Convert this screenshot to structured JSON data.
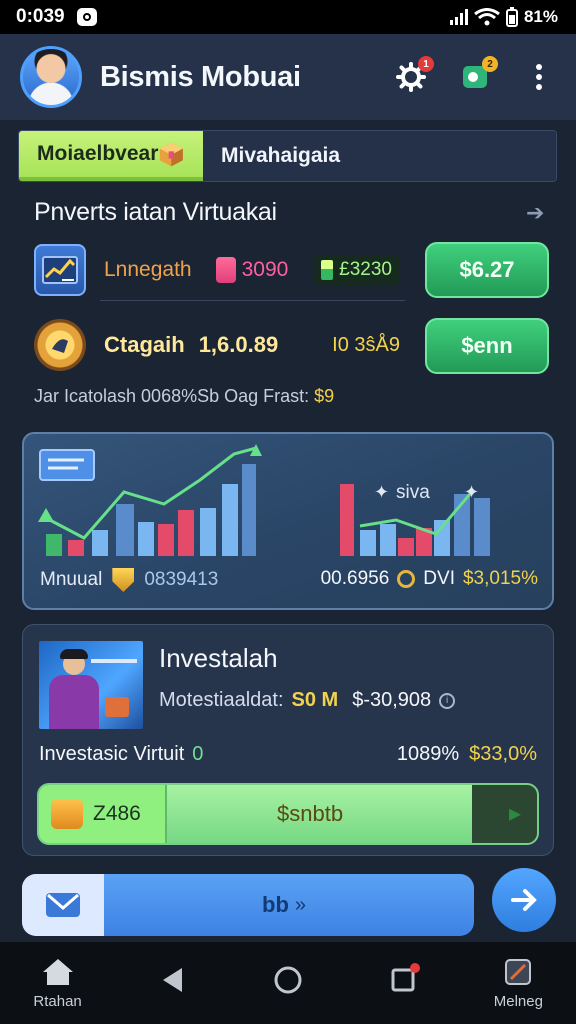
{
  "status_bar": {
    "time": "0:039",
    "battery": "81%"
  },
  "app_bar": {
    "title": "Bismis Mobuai",
    "settings_badge": "1",
    "notifications_badge": "2"
  },
  "tabs": [
    {
      "label": "Moiaelbvear",
      "active": true
    },
    {
      "label": "Mivahaigaia",
      "active": false
    }
  ],
  "section": {
    "title": "Pnverts iatan Virtuakai"
  },
  "assets": [
    {
      "name": "Lnnegath",
      "amount": "3090",
      "balance": "£3230",
      "button_label": "$6.27"
    },
    {
      "name": "Ctagaih",
      "amount": "1,6.0.89",
      "balance": "I0 3ŝÅ9",
      "button_label": "$enn"
    }
  ],
  "footnote": {
    "text": "Jar Icatolash 0068%Sb Oag Frast:",
    "value": "$9"
  },
  "market_card": {
    "label": "Mnuual",
    "code": "0839413",
    "value": "00.6956",
    "unit": "DVI",
    "change": "$3,015%",
    "legend_text": "siva"
  },
  "invest_card": {
    "title": "Investalah",
    "subtitle": "Motestiaaldat:",
    "subtitle_value": "S0 M",
    "amount": "$-30,908",
    "name": "Investasic Virtuit",
    "name_value": "0",
    "rate": "1089%",
    "rate_amount": "$33,0%",
    "progress": {
      "left_value": "Z486",
      "center_label": "$snbtb",
      "fraction": 0.87
    }
  },
  "bottom_action": {
    "label": "bb"
  },
  "nav": [
    {
      "label": "Rtahan"
    },
    {
      "label": ""
    },
    {
      "label": ""
    },
    {
      "label": ""
    },
    {
      "label": "Melneg"
    }
  ],
  "colors": {
    "accent_green": "#34c274",
    "accent_blue": "#3d82e3",
    "gold": "#f0d24c",
    "background": "#1b2433"
  }
}
